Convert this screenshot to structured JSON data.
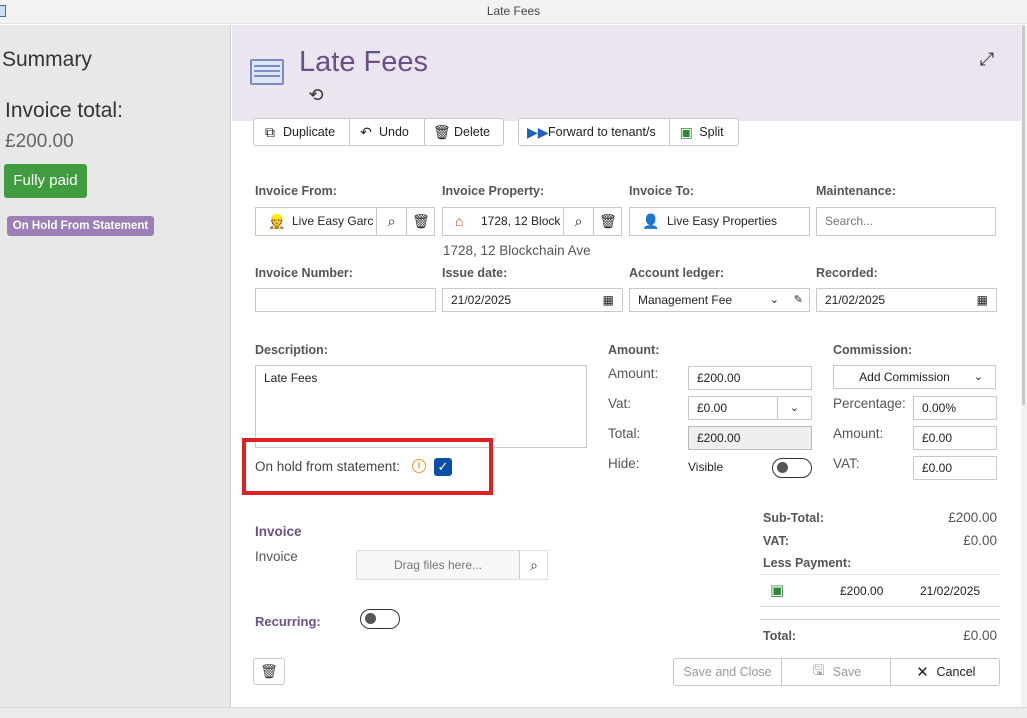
{
  "window": {
    "title": "Late Fees"
  },
  "summary": {
    "title": "Summary",
    "invoice_total_label": "Invoice total:",
    "invoice_total_value": "£200.00",
    "status_button": "Fully paid",
    "hold_badge": "On Hold From Statement"
  },
  "header": {
    "title": "Late Fees"
  },
  "toolbar": {
    "duplicate": "Duplicate",
    "undo": "Undo",
    "delete": "Delete",
    "forward": "Forward to tenant/s",
    "split": "Split"
  },
  "form": {
    "invoice_from": {
      "label": "Invoice From:",
      "value": "Live Easy Garc"
    },
    "invoice_property": {
      "label": "Invoice Property:",
      "value": "1728, 12 Block",
      "address": "1728, 12 Blockchain Ave"
    },
    "invoice_to": {
      "label": "Invoice To:",
      "value": "Live Easy Properties"
    },
    "maintenance": {
      "label": "Maintenance:",
      "placeholder": "Search..."
    },
    "invoice_number": {
      "label": "Invoice Number:",
      "value": ""
    },
    "issue_date": {
      "label": "Issue date:",
      "value": "21/02/2025"
    },
    "account_ledger": {
      "label": "Account ledger:",
      "value": "Management Fee"
    },
    "recorded": {
      "label": "Recorded:",
      "value": "21/02/2025"
    },
    "description": {
      "label": "Description:",
      "value": "Late Fees"
    },
    "on_hold": {
      "label": "On hold from statement:",
      "checked": true
    },
    "invoice_section": {
      "title": "Invoice",
      "label": "Invoice",
      "drop_placeholder": "Drag files here..."
    },
    "recurring": {
      "label": "Recurring:",
      "on": false
    }
  },
  "amount": {
    "section_label": "Amount:",
    "amount_label": "Amount:",
    "amount_value": "£200.00",
    "vat_label": "Vat:",
    "vat_value": "£0.00",
    "total_label": "Total:",
    "total_value": "£200.00",
    "hide_label": "Hide:",
    "hide_value": "Visible"
  },
  "commission": {
    "section_label": "Commission:",
    "add_button": "Add Commission",
    "percentage_label": "Percentage:",
    "percentage_value": "0.00%",
    "amount_label": "Amount:",
    "amount_value": "£0.00",
    "vat_label": "VAT:",
    "vat_value": "£0.00"
  },
  "totals": {
    "subtotal_label": "Sub-Total:",
    "subtotal_value": "£200.00",
    "vat_label": "VAT:",
    "vat_value": "£0.00",
    "less_payment_label": "Less Payment:",
    "payment_amount": "£200.00",
    "payment_date": "21/02/2025",
    "total_label": "Total:",
    "total_value": "£0.00"
  },
  "footer": {
    "save_close": "Save and Close",
    "save": "Save",
    "cancel": "Cancel"
  },
  "colors": {
    "accent_purple": "#6a5086",
    "paid_green": "#3f9d3f",
    "badge_purple": "#9b7fb6",
    "highlight_red": "#e02020",
    "checkbox_blue": "#0b4fa8"
  }
}
